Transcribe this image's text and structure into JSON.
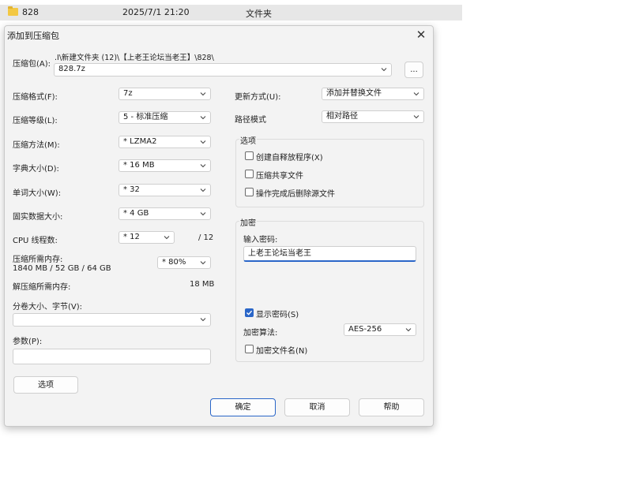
{
  "explorer_row": {
    "name": "828",
    "date": "2025/7/1 21:20",
    "type": "文件夹"
  },
  "dialog": {
    "title": "添加到压缩包",
    "close_glyph": "✕"
  },
  "archive": {
    "label": "压缩包(A):",
    "path": ".I\\新建文件夹 (12)\\【上老王论坛当老王】\\828\\",
    "filename": "828.7z",
    "browse_label": "..."
  },
  "left": {
    "format": {
      "label": "压缩格式(F):",
      "value": "7z"
    },
    "level": {
      "label": "压缩等级(L):",
      "value": "5 - 标准压缩"
    },
    "method": {
      "label": "压缩方法(M):",
      "value": "*  LZMA2"
    },
    "dict": {
      "label": "字典大小(D):",
      "value": "*  16 MB"
    },
    "word": {
      "label": "单词大小(W):",
      "value": "*  32"
    },
    "solid": {
      "label": "固实数据大小:",
      "value": "*  4 GB"
    },
    "threads": {
      "label": "CPU 线程数:",
      "value": "*  12",
      "suffix": "/ 12"
    },
    "mem_compress": {
      "label": "压缩所需内存:",
      "detail": "1840 MB / 52 GB / 64 GB",
      "value": "*  80%"
    },
    "mem_decompress": {
      "label": "解压缩所需内存:",
      "value": "18 MB"
    },
    "split": {
      "label": "分卷大小、字节(V):",
      "value": ""
    },
    "params": {
      "label": "参数(P):",
      "value": ""
    },
    "options_button": "选项"
  },
  "right": {
    "update": {
      "label": "更新方式(U):",
      "value": "添加并替换文件"
    },
    "pathmode": {
      "label": "路径模式",
      "value": "相对路径"
    },
    "options_group": {
      "title": "选项",
      "items": [
        {
          "label": "创建自释放程序(X)",
          "checked": false
        },
        {
          "label": "压缩共享文件",
          "checked": false
        },
        {
          "label": "操作完成后删除源文件",
          "checked": false
        }
      ]
    },
    "encrypt_group": {
      "title": "加密",
      "password_label": "输入密码:",
      "password_value": "上老王论坛当老王",
      "show_password": {
        "label": "显示密码(S)",
        "checked": true
      },
      "algo_label": "加密算法:",
      "algo_value": "AES-256",
      "encrypt_names": {
        "label": "加密文件名(N)",
        "checked": false
      }
    }
  },
  "buttons": {
    "ok": "确定",
    "cancel": "取消",
    "help": "帮助"
  }
}
